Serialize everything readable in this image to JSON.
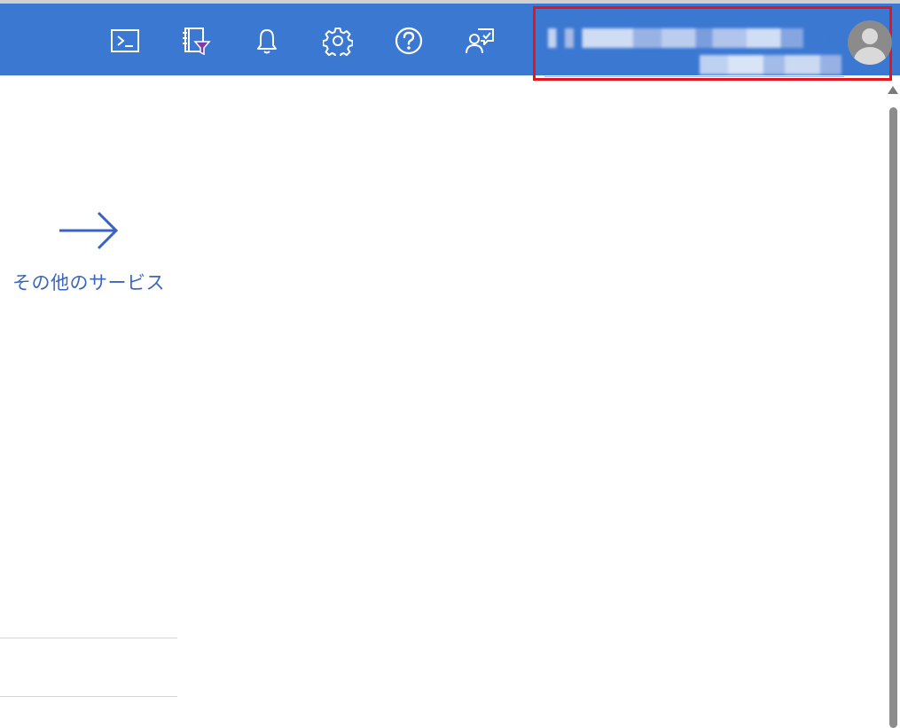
{
  "toolbar": {
    "buttons": [
      {
        "name": "cloud-shell-button",
        "icon": "terminal-icon"
      },
      {
        "name": "directory-subscription-filter-button",
        "icon": "book-filter-icon"
      },
      {
        "name": "notifications-button",
        "icon": "bell-icon"
      },
      {
        "name": "settings-button",
        "icon": "gear-icon"
      },
      {
        "name": "help-button",
        "icon": "question-circle-icon"
      },
      {
        "name": "feedback-button",
        "icon": "person-feedback-icon"
      }
    ],
    "colors": {
      "background": "#3b78d2",
      "highlight_border": "#e8141b"
    }
  },
  "account": {
    "avatar_icon": "default-user-avatar-icon"
  },
  "main": {
    "more_services": {
      "icon": "arrow-right-icon",
      "label": "その他のサービス",
      "color": "#3b66bf"
    }
  },
  "scrollbar": {
    "up_icon": "triangle-up-icon"
  }
}
